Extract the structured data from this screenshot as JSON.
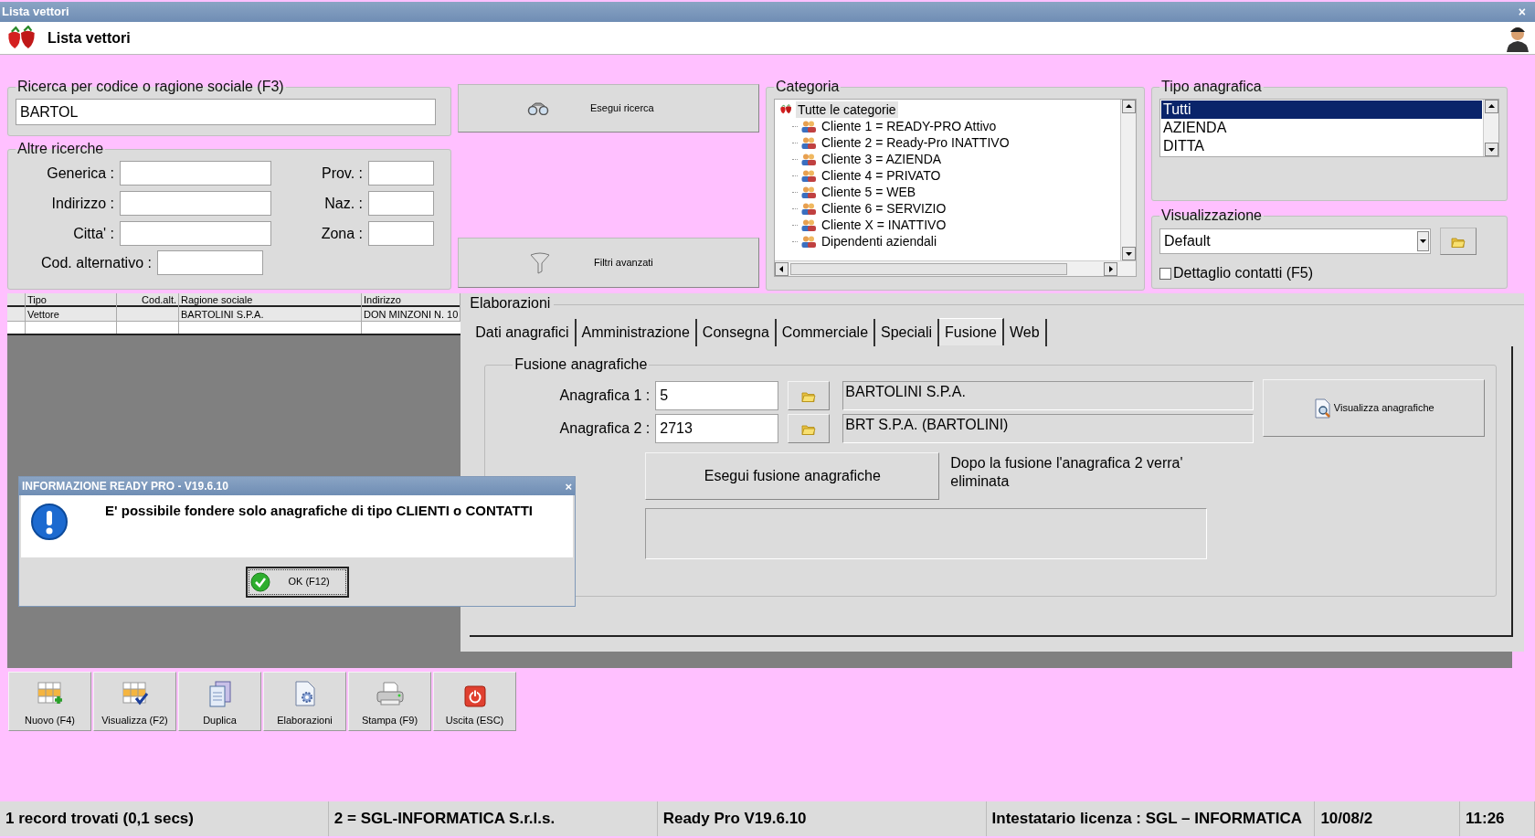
{
  "window": {
    "title": "Lista vettori",
    "close": "×"
  },
  "header": {
    "title": "Lista vettori"
  },
  "search": {
    "legend": "Ricerca per codice o ragione sociale (F3)",
    "value": "BARTOL"
  },
  "other_search": {
    "legend": "Altre ricerche",
    "left_fields": [
      "Generica :",
      "Indirizzo :",
      "Citta' :"
    ],
    "right_fields": [
      "Prov. :",
      "Naz. :",
      "Zona :"
    ],
    "bottom_field": "Cod. alternativo :"
  },
  "search_button": "Esegui ricerca",
  "filter_button": "Filtri avanzati",
  "category": {
    "legend": "Categoria",
    "tree": [
      {
        "label": "Tutte le categorie",
        "selected": true,
        "children": [
          {
            "label": "Cliente 1 = READY-PRO Attivo",
            "selected": false
          },
          {
            "label": "Cliente 2 = Ready-Pro INATTIVO",
            "selected": false
          },
          {
            "label": "Cliente 3 = AZIENDA",
            "selected": false
          },
          {
            "label": "Cliente 4 = PRIVATO",
            "selected": false
          },
          {
            "label": "Cliente 5 = WEB",
            "selected": false
          },
          {
            "label": "Cliente 6 = SERVIZIO",
            "selected": false
          },
          {
            "label": "Cliente X = INATTIVO",
            "selected": false
          },
          {
            "label": "Dipendenti aziendali",
            "selected": false
          }
        ]
      }
    ]
  },
  "type": {
    "legend": "Tipo anagrafica",
    "items": [
      {
        "label": "Tutti",
        "selected": true
      },
      {
        "label": "AZIENDA",
        "selected": false
      },
      {
        "label": "DITTA",
        "selected": false
      }
    ]
  },
  "view": {
    "legend": "Visualizzazione",
    "value": "Default",
    "checkbox": {
      "label": "Dettaglio contatti (F5)",
      "checked": false
    }
  },
  "table": {
    "columns": [
      "Tipo",
      "Cod.alt.",
      "Ragione sociale",
      "Indirizzo"
    ],
    "rows": [
      [
        "Vettore",
        "",
        "BARTOLINI S.P.A.",
        "DON MINZONI N. 10"
      ]
    ]
  },
  "elaborazioni": {
    "legend": "Elaborazioni",
    "tabs": [
      {
        "label": "Dati anagrafici",
        "selected": false
      },
      {
        "label": "Amministrazione",
        "selected": false
      },
      {
        "label": "Consegna",
        "selected": false
      },
      {
        "label": "Commerciale",
        "selected": false
      },
      {
        "label": "Speciali",
        "selected": false
      },
      {
        "label": "Fusione",
        "selected": true
      },
      {
        "label": "Web",
        "selected": false
      }
    ],
    "group": {
      "legend": "Fusione anagrafiche",
      "rows": [
        {
          "label": "Anagrafica 1 :",
          "code": "5",
          "name": "BARTOLINI S.P.A."
        },
        {
          "label": "Anagrafica 2 :",
          "code": "2713",
          "name": "BRT S.P.A. (BARTOLINI)"
        }
      ],
      "view_button": "Visualizza anagrafiche",
      "merge_button": "Esegui fusione anagrafiche",
      "note": "Dopo la fusione l'anagrafica 2 verra' eliminata"
    }
  },
  "toolbar": [
    {
      "label": "Nuovo (F4)",
      "kind": "new"
    },
    {
      "label": "Visualizza (F2)",
      "kind": "view"
    },
    {
      "label": "Duplica",
      "kind": "copy"
    },
    {
      "label": "Elaborazioni",
      "kind": "process"
    },
    {
      "label": "Stampa (F9)",
      "kind": "print"
    },
    {
      "label": "Uscita (ESC)",
      "kind": "exit"
    }
  ],
  "status_bar": [
    "1 record trovati (0,1 secs)",
    "2 = SGL-INFORMATICA S.r.l.s.",
    "Ready Pro V19.6.10",
    "Intestatario licenza : SGL – INFORMATICA",
    "10/08/2",
    "11:26"
  ],
  "dialog": {
    "title": "INFORMAZIONE READY PRO - V19.6.10",
    "close": "×",
    "message": "E' possibile fondere solo anagrafiche di tipo CLIENTI o CONTATTI",
    "ok": "OK (F12)"
  }
}
